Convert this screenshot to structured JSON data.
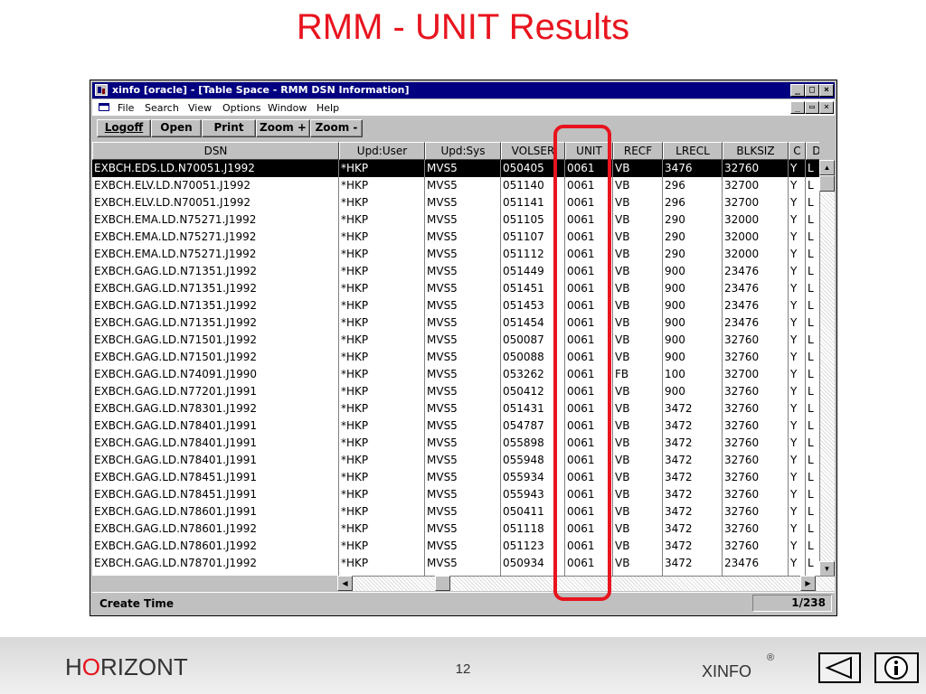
{
  "slide": {
    "title": "RMM - UNIT Results",
    "brand_accent": "O",
    "brand_h": "H",
    "brand_rest": "RIZONT",
    "page_number": "12",
    "product": "XINFO",
    "registered_mark": "®",
    "title_color": "#e8141e"
  },
  "window": {
    "title": "xinfo [oracle] - [Table Space - RMM DSN Information]",
    "controls": [
      "_",
      "□",
      "×"
    ],
    "child_controls": [
      "_",
      "▭",
      "×"
    ]
  },
  "menu": {
    "items": [
      "File",
      "Search",
      "View",
      "Options",
      "Window",
      "Help"
    ]
  },
  "toolbar": {
    "buttons": [
      "Logoff",
      "Open",
      "Print",
      "Zoom +",
      "Zoom -"
    ]
  },
  "table": {
    "columns": [
      "DSN",
      "Upd:User",
      "Upd:Sys",
      "VOLSER",
      "UNIT",
      "RECF",
      "LRECL",
      "BLKSIZ",
      "C",
      "Ds"
    ],
    "rows": [
      [
        "EXBCH.EDS.LD.N70051.J1992",
        "*HKP",
        "MVS5",
        "050405",
        "0061",
        "VB",
        "3476",
        "32760",
        "Y",
        "L"
      ],
      [
        "EXBCH.ELV.LD.N70051.J1992",
        "*HKP",
        "MVS5",
        "051140",
        "0061",
        "VB",
        "296",
        "32700",
        "Y",
        "L"
      ],
      [
        "EXBCH.ELV.LD.N70051.J1992",
        "*HKP",
        "MVS5",
        "051141",
        "0061",
        "VB",
        "296",
        "32700",
        "Y",
        "L"
      ],
      [
        "EXBCH.EMA.LD.N75271.J1992",
        "*HKP",
        "MVS5",
        "051105",
        "0061",
        "VB",
        "290",
        "32000",
        "Y",
        "L"
      ],
      [
        "EXBCH.EMA.LD.N75271.J1992",
        "*HKP",
        "MVS5",
        "051107",
        "0061",
        "VB",
        "290",
        "32000",
        "Y",
        "L"
      ],
      [
        "EXBCH.EMA.LD.N75271.J1992",
        "*HKP",
        "MVS5",
        "051112",
        "0061",
        "VB",
        "290",
        "32000",
        "Y",
        "L"
      ],
      [
        "EXBCH.GAG.LD.N71351.J1992",
        "*HKP",
        "MVS5",
        "051449",
        "0061",
        "VB",
        "900",
        "23476",
        "Y",
        "L"
      ],
      [
        "EXBCH.GAG.LD.N71351.J1992",
        "*HKP",
        "MVS5",
        "051451",
        "0061",
        "VB",
        "900",
        "23476",
        "Y",
        "L"
      ],
      [
        "EXBCH.GAG.LD.N71351.J1992",
        "*HKP",
        "MVS5",
        "051453",
        "0061",
        "VB",
        "900",
        "23476",
        "Y",
        "L"
      ],
      [
        "EXBCH.GAG.LD.N71351.J1992",
        "*HKP",
        "MVS5",
        "051454",
        "0061",
        "VB",
        "900",
        "23476",
        "Y",
        "L"
      ],
      [
        "EXBCH.GAG.LD.N71501.J1992",
        "*HKP",
        "MVS5",
        "050087",
        "0061",
        "VB",
        "900",
        "32760",
        "Y",
        "L"
      ],
      [
        "EXBCH.GAG.LD.N71501.J1992",
        "*HKP",
        "MVS5",
        "050088",
        "0061",
        "VB",
        "900",
        "32760",
        "Y",
        "L"
      ],
      [
        "EXBCH.GAG.LD.N74091.J1990",
        "*HKP",
        "MVS5",
        "053262",
        "0061",
        "FB",
        "100",
        "32700",
        "Y",
        "L"
      ],
      [
        "EXBCH.GAG.LD.N77201.J1991",
        "*HKP",
        "MVS5",
        "050412",
        "0061",
        "VB",
        "900",
        "32760",
        "Y",
        "L"
      ],
      [
        "EXBCH.GAG.LD.N78301.J1992",
        "*HKP",
        "MVS5",
        "051431",
        "0061",
        "VB",
        "3472",
        "32760",
        "Y",
        "L"
      ],
      [
        "EXBCH.GAG.LD.N78401.J1991",
        "*HKP",
        "MVS5",
        "054787",
        "0061",
        "VB",
        "3472",
        "32760",
        "Y",
        "L"
      ],
      [
        "EXBCH.GAG.LD.N78401.J1991",
        "*HKP",
        "MVS5",
        "055898",
        "0061",
        "VB",
        "3472",
        "32760",
        "Y",
        "L"
      ],
      [
        "EXBCH.GAG.LD.N78401.J1991",
        "*HKP",
        "MVS5",
        "055948",
        "0061",
        "VB",
        "3472",
        "32760",
        "Y",
        "L"
      ],
      [
        "EXBCH.GAG.LD.N78451.J1991",
        "*HKP",
        "MVS5",
        "055934",
        "0061",
        "VB",
        "3472",
        "32760",
        "Y",
        "L"
      ],
      [
        "EXBCH.GAG.LD.N78451.J1991",
        "*HKP",
        "MVS5",
        "055943",
        "0061",
        "VB",
        "3472",
        "32760",
        "Y",
        "L"
      ],
      [
        "EXBCH.GAG.LD.N78601.J1991",
        "*HKP",
        "MVS5",
        "050411",
        "0061",
        "VB",
        "3472",
        "32760",
        "Y",
        "L"
      ],
      [
        "EXBCH.GAG.LD.N78601.J1992",
        "*HKP",
        "MVS5",
        "051118",
        "0061",
        "VB",
        "3472",
        "32760",
        "Y",
        "L"
      ],
      [
        "EXBCH.GAG.LD.N78601.J1992",
        "*HKP",
        "MVS5",
        "051123",
        "0061",
        "VB",
        "3472",
        "32760",
        "Y",
        "L"
      ],
      [
        "EXBCH.GAG.LD.N78701.J1992",
        "*HKP",
        "MVS5",
        "050934",
        "0061",
        "VB",
        "3472",
        "23476",
        "Y",
        "L"
      ]
    ],
    "selected_row": 0
  },
  "status": {
    "text": "Create Time",
    "count": "1/238"
  },
  "icons": {
    "app": "app-icon",
    "doc": "document-icon",
    "back": "back-arrow-icon",
    "info": "info-icon"
  }
}
